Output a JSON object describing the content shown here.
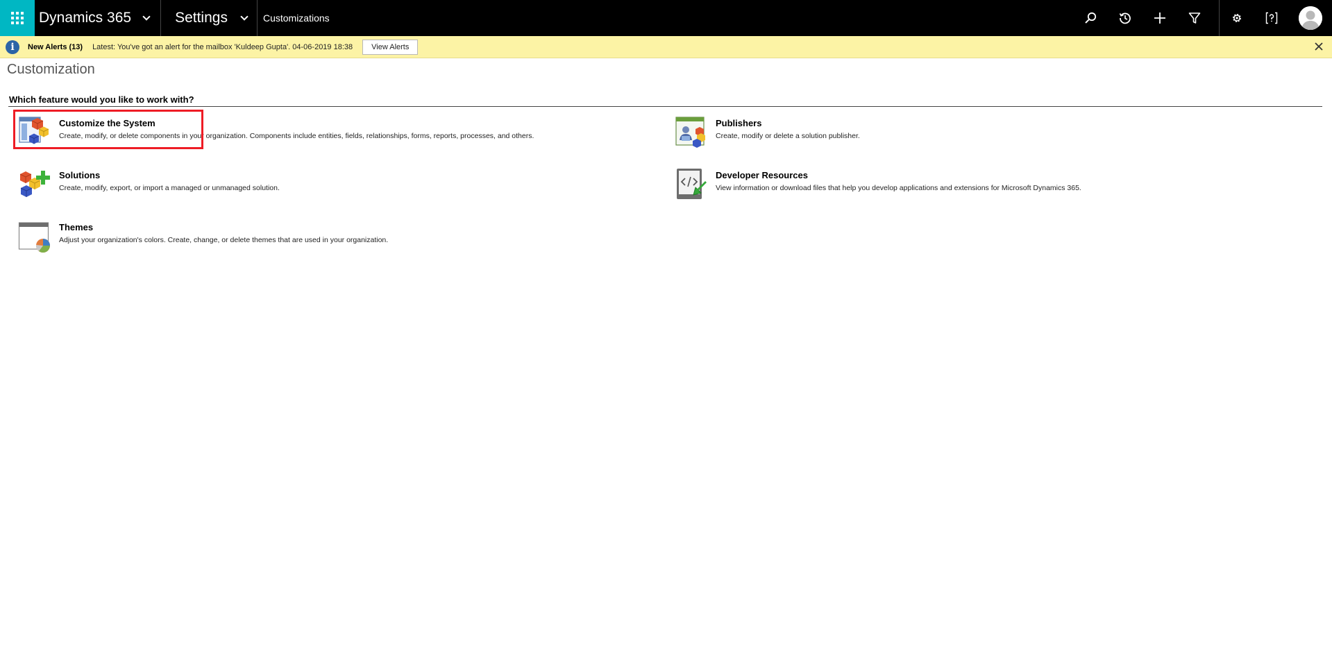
{
  "nav": {
    "app_name": "Dynamics 365",
    "area": "Settings",
    "breadcrumb": "Customizations",
    "icons": [
      "search-icon",
      "recent-icon",
      "new-icon",
      "filter-icon",
      "settings-icon",
      "help-icon",
      "user-avatar"
    ]
  },
  "alert": {
    "title": "New Alerts (13)",
    "message": "Latest: You've got an alert for the mailbox 'Kuldeep Gupta'. 04-06-2019 18:38",
    "button": "View Alerts"
  },
  "page": {
    "title": "Customization",
    "question": "Which feature would you like to work with?"
  },
  "features": {
    "customize": {
      "title": "Customize the System",
      "desc": "Create, modify, or delete components in your organization. Components include entities, fields, relationships, forms, reports, processes, and others."
    },
    "solutions": {
      "title": "Solutions",
      "desc": "Create, modify, export, or import a managed or unmanaged solution."
    },
    "themes": {
      "title": "Themes",
      "desc": "Adjust your organization's colors. Create, change, or delete themes that are used in your organization."
    },
    "publishers": {
      "title": "Publishers",
      "desc": "Create, modify or delete a solution publisher."
    },
    "devres": {
      "title": "Developer Resources",
      "desc": "View information or download files that help you develop applications and extensions for Microsoft Dynamics 365."
    }
  },
  "colors": {
    "nav_bg": "#000000",
    "waffle_bg": "#00b7c3",
    "alert_bg": "#fcf3a5",
    "highlight": "#ee1c25"
  }
}
